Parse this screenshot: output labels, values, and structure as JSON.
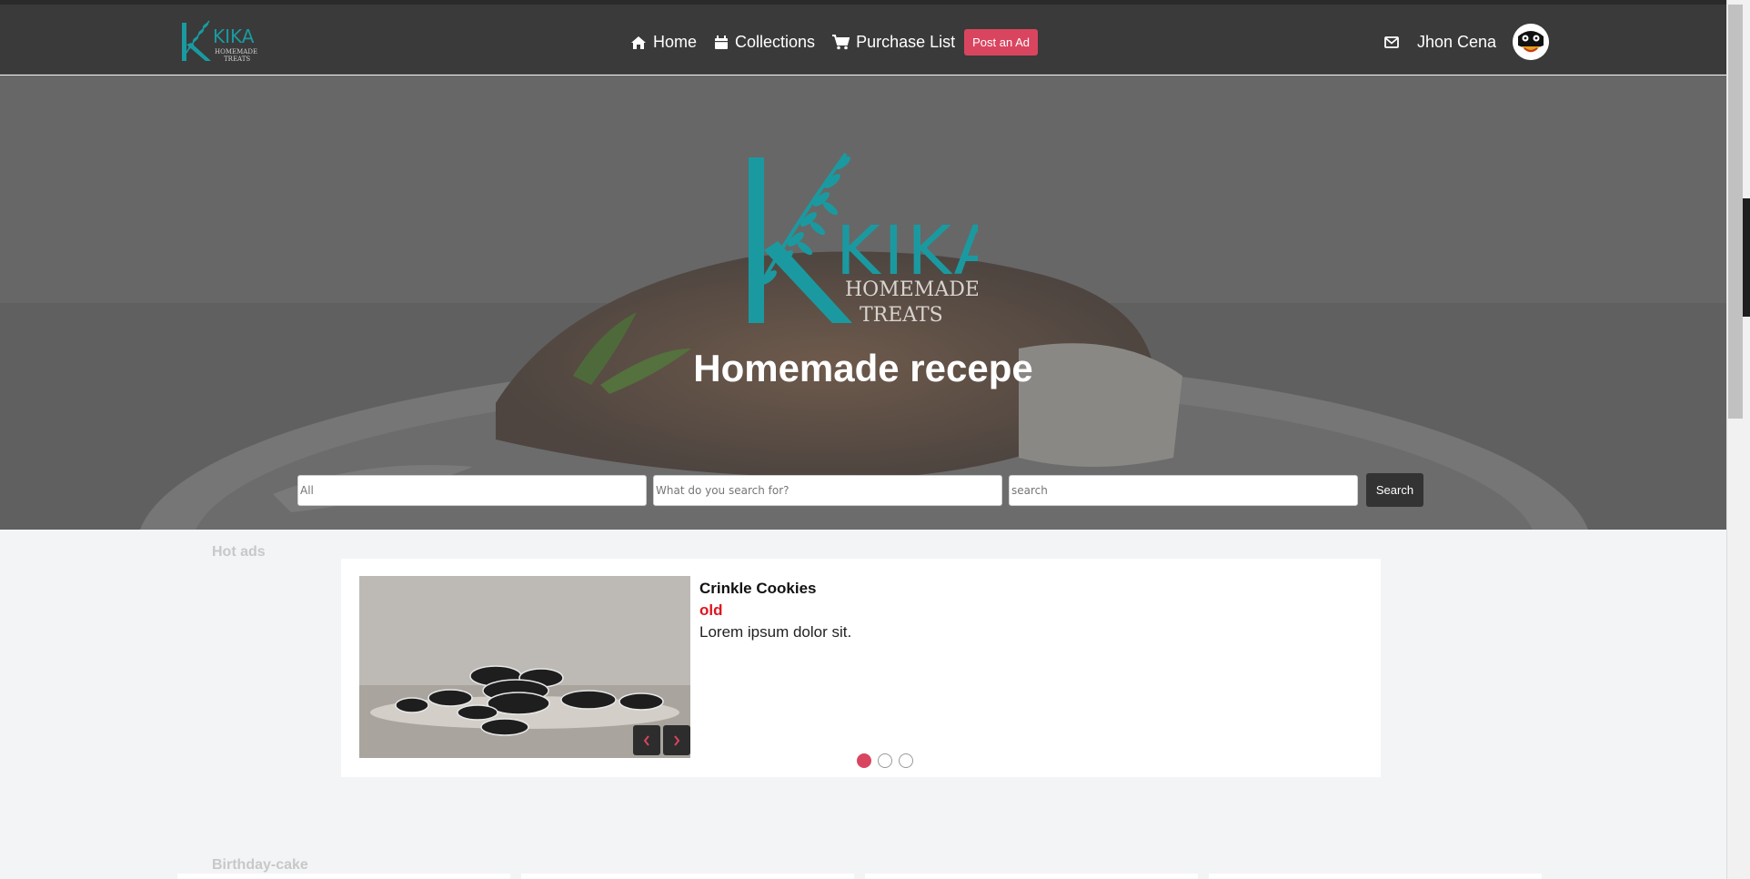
{
  "nav": {
    "brand": {
      "name": "KIKA",
      "tagline_1": "HOMEMADE",
      "tagline_2": "TREATS"
    },
    "links": [
      {
        "label": "Home",
        "icon": "home-icon"
      },
      {
        "label": "Collections",
        "icon": "calendar-icon"
      },
      {
        "label": "Purchase List",
        "icon": "cart-icon"
      }
    ],
    "post_ad_label": "Post an Ad",
    "user_name": "Jhon Cena",
    "mail_icon": "envelope-icon",
    "accent": "#d9455f",
    "brand_color": "#1a9aa0"
  },
  "hero": {
    "title": "Homemade recepe",
    "search": {
      "category_placeholder": "All",
      "query_placeholder": "What do you search for?",
      "location_placeholder": "search",
      "button_label": "Search"
    }
  },
  "hot_ads": {
    "label": "Hot ads",
    "item": {
      "title": "Crinkle Cookies",
      "status": "old",
      "description": "Lorem ipsum dolor sit."
    },
    "slides_total": 3,
    "active_slide": 1
  },
  "birthday": {
    "label": "Birthday-cake"
  }
}
